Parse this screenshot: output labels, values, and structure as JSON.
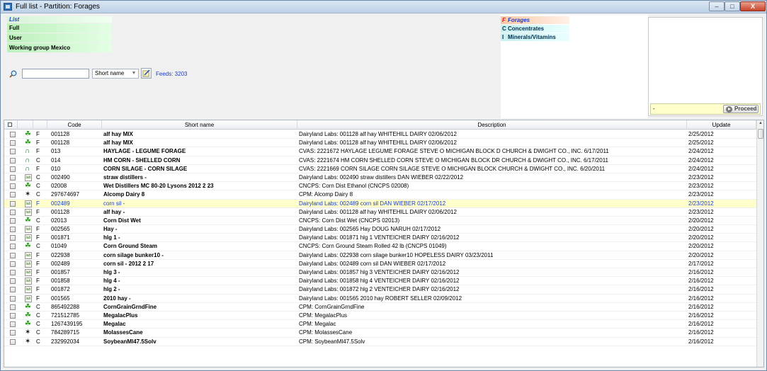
{
  "window": {
    "title": "Full list - Partition: Forages",
    "min_label": "–",
    "max_label": "□",
    "close_label": "X"
  },
  "lists": {
    "header": "List",
    "items": [
      "Full",
      "User",
      "Working group Mexico"
    ]
  },
  "search": {
    "value": "",
    "select_value": "Short name",
    "feeds_label": "Feeds: 3203"
  },
  "partitions": [
    {
      "key": "F",
      "label": "Forages"
    },
    {
      "key": "C",
      "label": "Concentrates"
    },
    {
      "key": "I",
      "label": "Minerals/Vitamins"
    }
  ],
  "proceed": {
    "field_text": "-",
    "button_label": "Proceed"
  },
  "grid": {
    "headers": {
      "code": "Code",
      "short": "Short name",
      "desc": "Description",
      "update": "Update"
    },
    "rows": [
      {
        "icon": "leaf-icon",
        "part": "F",
        "code": "001128",
        "short": "alf hay MIX",
        "desc": "Dairyland Labs: 001128 alf hay  WHITEHILL DAIRY    02/06/2012",
        "update": "2/25/2012"
      },
      {
        "icon": "leaf-icon",
        "part": "F",
        "code": "001128",
        "short": "alf hay MIX",
        "desc": "Dairyland Labs: 001128 alf hay  WHITEHILL DAIRY    02/06/2012",
        "update": "2/25/2012"
      },
      {
        "icon": "arch-icon",
        "part": "F",
        "code": "013",
        "short": "HAYLAGE - LEGUME FORAGE",
        "desc": "CVAS: 2221672 HAYLAGE LEGUME FORAGE STEVE O     MICHIGAN BLOCK D CHURCH & DWIGHT CO., INC. 6/17/2011",
        "update": "2/24/2012"
      },
      {
        "icon": "arch-icon",
        "part": "C",
        "code": "014",
        "short": "HM CORN - SHELLED CORN",
        "desc": "CVAS: 2221674 HM CORN SHELLED CORN STEVE O     MICHIGAN BLOCK DR CHURCH & DWIGHT CO., INC. 6/17/2011",
        "update": "2/24/2012"
      },
      {
        "icon": "arch-icon",
        "part": "F",
        "code": "010",
        "short": "CORN SILAGE - CORN SILAGE",
        "desc": "CVAS: 2221669 CORN SILAGE CORN SILAGE STEVE O     MICHIGAN BLOCK CHURCH & DWIGHT CO., INC. 6/20/2011",
        "update": "2/24/2012"
      },
      {
        "icon": "analysis-icon",
        "part": "C",
        "code": "002490",
        "short": "straw distillers -",
        "desc": "Dairyland Labs: 002490 straw distillers  DAN WIEBER    02/22/2012",
        "update": "2/23/2012"
      },
      {
        "icon": "leaf-icon",
        "part": "C",
        "code": "02008",
        "short": "Wet Distillers MC 80-20 Lysons 2012 2 23",
        "desc": "CNCPS: Corn Dist Ethanol (CNCPS 02008)",
        "update": "2/23/2012"
      },
      {
        "icon": "sampler-icon",
        "part": "C",
        "code": "297674697",
        "short": "Alcomp Dairy 8",
        "desc": "CPM: Alcomp Dairy 8",
        "update": "2/23/2012"
      },
      {
        "icon": "analysis-icon",
        "part": "F",
        "code": "002489",
        "short": "corn sil -",
        "desc": "Dairyland Labs: 002489 corn sil  DAN WIEBER    02/17/2012",
        "update": "2/23/2012",
        "highlight": true
      },
      {
        "icon": "analysis-icon",
        "part": "F",
        "code": "001128",
        "short": "alf hay -",
        "desc": "Dairyland Labs: 001128 alf hay  WHITEHILL DAIRY    02/06/2012",
        "update": "2/23/2012"
      },
      {
        "icon": "leaf-icon",
        "part": "C",
        "code": "02013",
        "short": "Corn Dist Wet",
        "desc": "CNCPS: Corn Dist Wet (CNCPS 02013)",
        "update": "2/20/2012"
      },
      {
        "icon": "analysis-icon",
        "part": "F",
        "code": "002565",
        "short": "Hay -",
        "desc": "Dairyland Labs: 002565 Hay  DOUG NARUH    02/17/2012",
        "update": "2/20/2012"
      },
      {
        "icon": "analysis-icon",
        "part": "F",
        "code": "001871",
        "short": "hlg 1 -",
        "desc": "Dairyland Labs: 001871 hlg 1  VENTEICHER DAIRY    02/16/2012",
        "update": "2/20/2012"
      },
      {
        "icon": "leaf-icon",
        "part": "C",
        "code": "01049",
        "short": "Corn Ground Steam",
        "desc": "CNCPS: Corn Ground Steam Rolled 42 lb (CNCPS 01049)",
        "update": "2/20/2012"
      },
      {
        "icon": "analysis-icon",
        "part": "F",
        "code": "022938",
        "short": "corn silage bunker10 -",
        "desc": "Dairyland Labs: 022938 corn silage bunker10  HOPELESS DAIRY    03/23/2011",
        "update": "2/20/2012"
      },
      {
        "icon": "analysis-icon",
        "part": "F",
        "code": "002489",
        "short": "corn sil - 2012 2 17",
        "desc": "Dairyland Labs: 002489 corn sil  DAN WIEBER    02/17/2012",
        "update": "2/17/2012"
      },
      {
        "icon": "analysis-icon",
        "part": "F",
        "code": "001857",
        "short": "hlg 3 -",
        "desc": "Dairyland Labs: 001857 hlg 3  VENTEICHER DAIRY    02/16/2012",
        "update": "2/16/2012"
      },
      {
        "icon": "analysis-icon",
        "part": "F",
        "code": "001858",
        "short": "hlg 4 -",
        "desc": "Dairyland Labs: 001858 hlg 4  VENTEICHER DAIRY    02/16/2012",
        "update": "2/16/2012"
      },
      {
        "icon": "analysis-icon",
        "part": "F",
        "code": "001872",
        "short": "hlg 2 -",
        "desc": "Dairyland Labs: 001872 hlg 2  VENTEICHER DAIRY    02/16/2012",
        "update": "2/16/2012"
      },
      {
        "icon": "analysis-icon",
        "part": "F",
        "code": "001565",
        "short": "2010 hay -",
        "desc": "Dairyland Labs: 001565 2010 hay  ROBERT SELLER    02/09/2012",
        "update": "2/16/2012"
      },
      {
        "icon": "leaf-icon",
        "part": "C",
        "code": "865492288",
        "short": "CornGrainGrndFine",
        "desc": "CPM: CornGrainGrndFine",
        "update": "2/16/2012"
      },
      {
        "icon": "leaf-icon",
        "part": "C",
        "code": "721512785",
        "short": "MegalacPlus",
        "desc": "CPM: MegalacPlus",
        "update": "2/16/2012"
      },
      {
        "icon": "leaf-icon",
        "part": "C",
        "code": "1267439195",
        "short": "Megalac",
        "desc": "CPM: Megalac",
        "update": "2/16/2012"
      },
      {
        "icon": "sampler-icon",
        "part": "C",
        "code": "784289715",
        "short": "MolassesCane",
        "desc": "CPM: MolassesCane",
        "update": "2/16/2012"
      },
      {
        "icon": "sampler-icon",
        "part": "C",
        "code": "232992034",
        "short": "SoybeanMl47.5Solv",
        "desc": "CPM: SoybeanMl47.5Solv",
        "update": "2/16/2012"
      }
    ]
  }
}
